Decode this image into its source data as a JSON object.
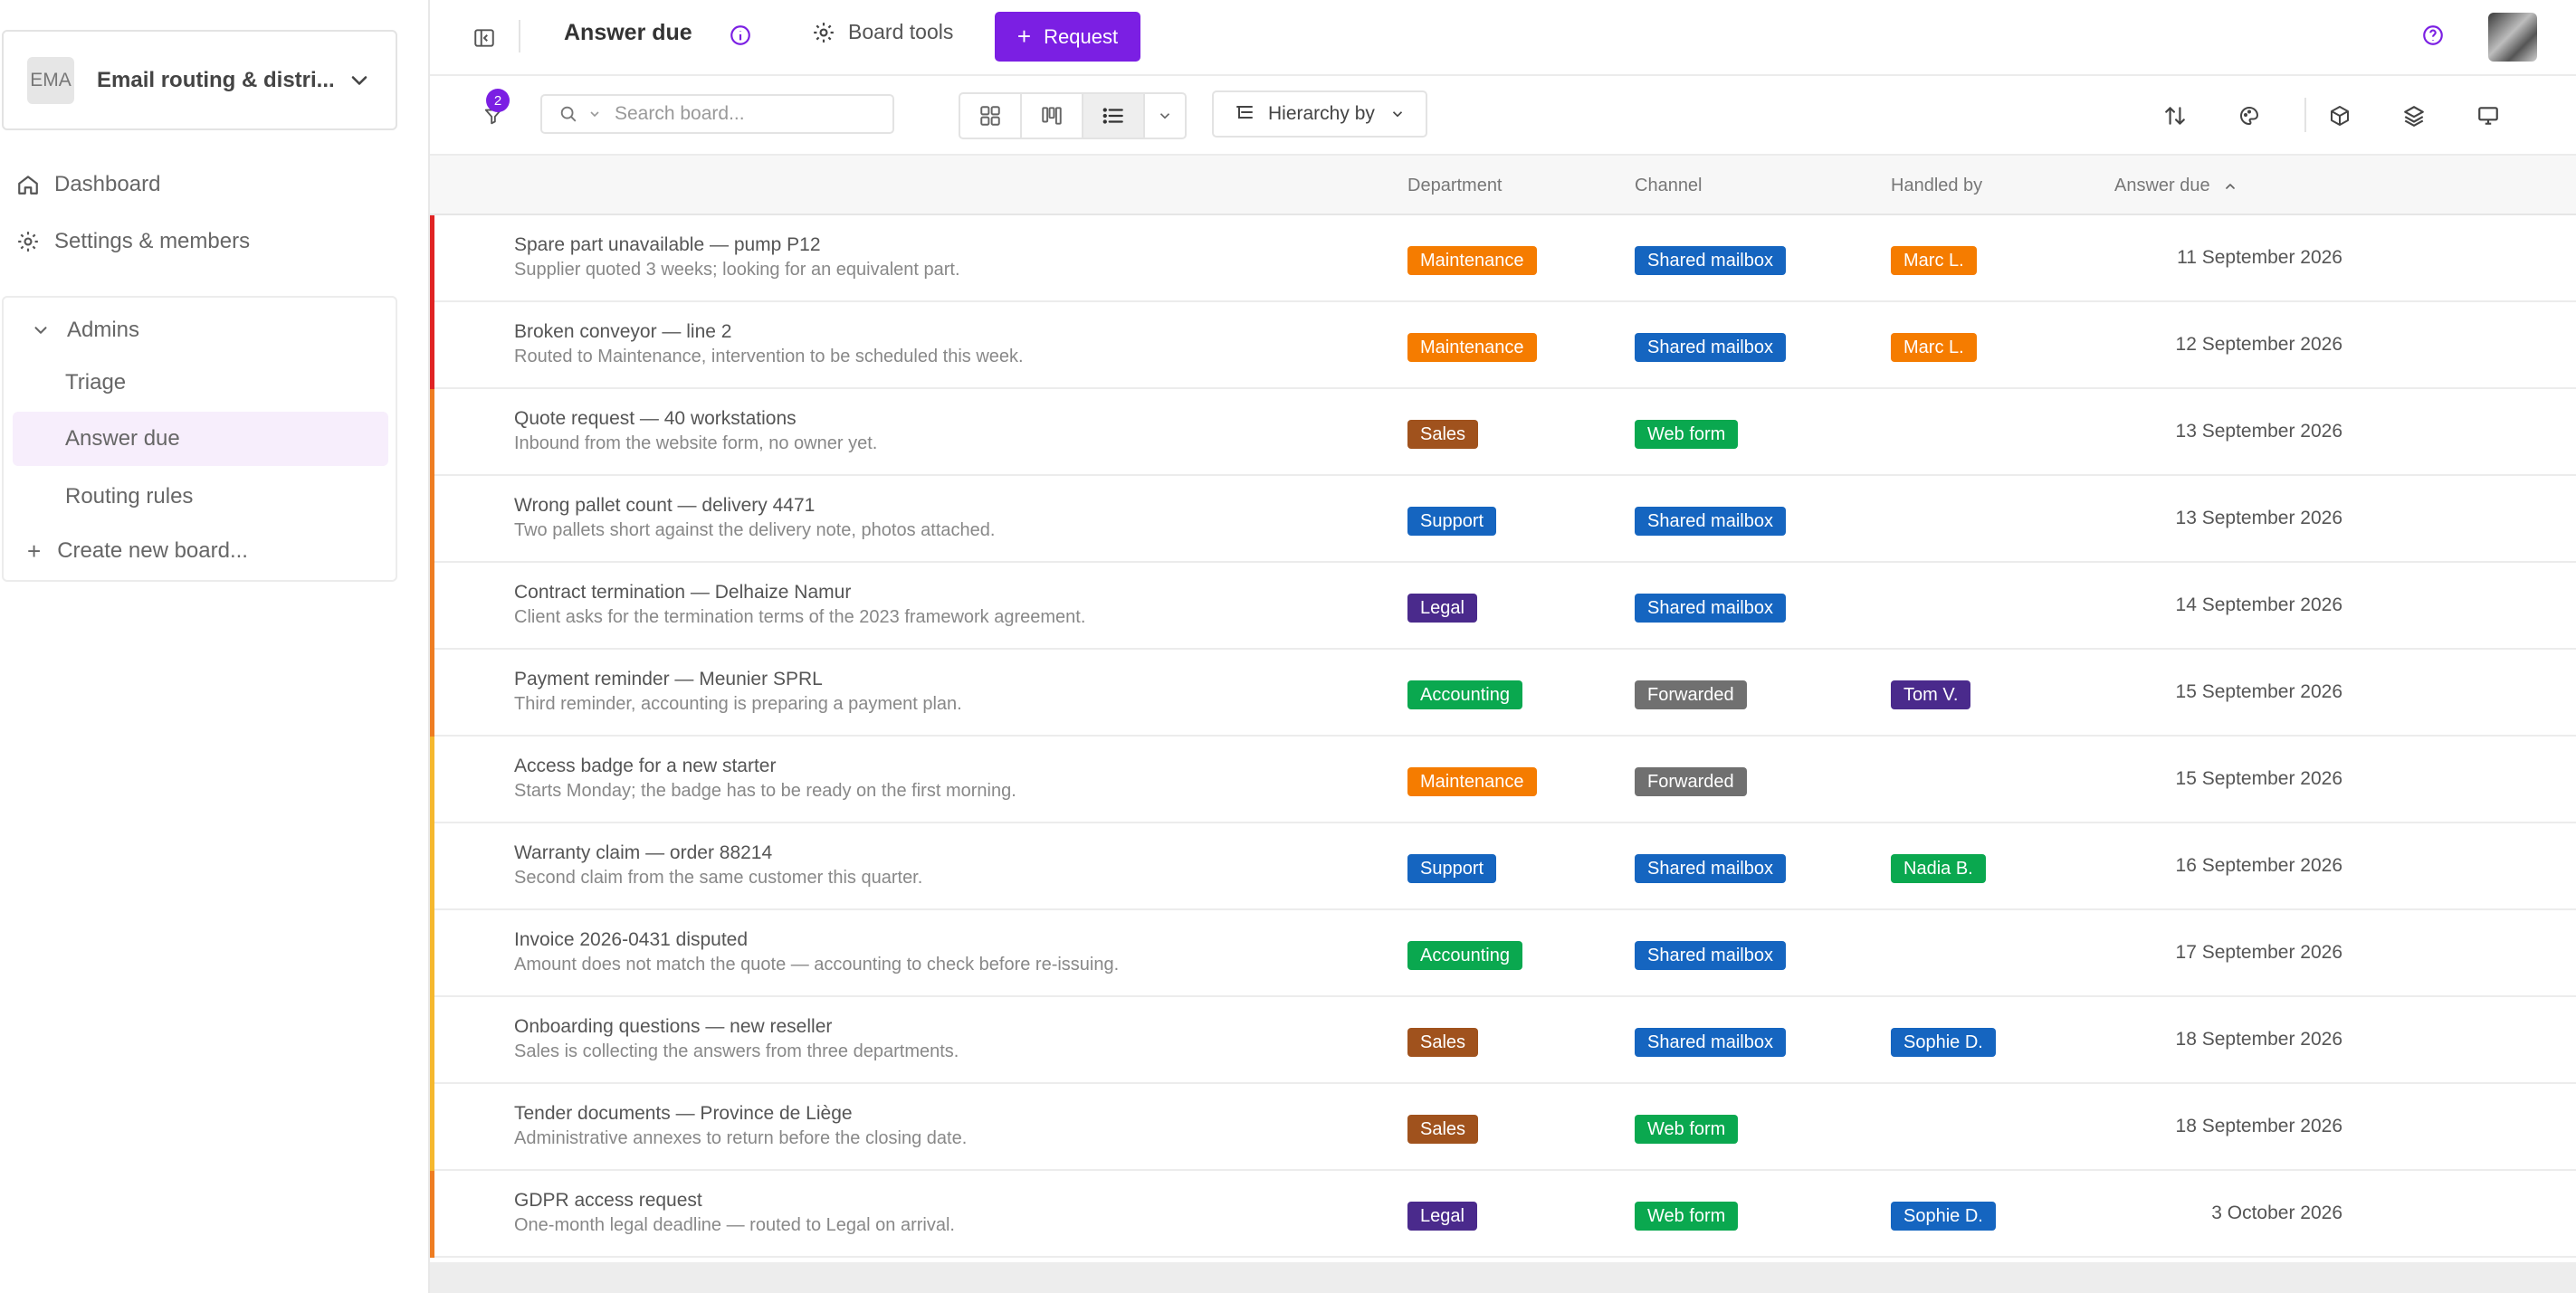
{
  "sidebar": {
    "workspace": {
      "initials": "EMA",
      "name": "Email routing & distri..."
    },
    "links": [
      {
        "label": "Dashboard",
        "icon": "home-icon"
      },
      {
        "label": "Settings & members",
        "icon": "gear-icon"
      }
    ],
    "group": {
      "label": "Admins",
      "boards": [
        "Triage",
        "Answer due",
        "Routing rules"
      ],
      "active_index": 1,
      "create_label": "Create new board..."
    }
  },
  "topbar": {
    "title": "Answer due",
    "board_tools_label": "Board tools",
    "request_label": "Request"
  },
  "toolbar": {
    "filter_count": "2",
    "search_placeholder": "Search board...",
    "hierarchy_label": "Hierarchy by"
  },
  "table": {
    "columns": {
      "department": "Department",
      "channel": "Channel",
      "handled_by": "Handled by",
      "answer_due": "Answer due"
    },
    "rows": [
      {
        "title": "Spare part unavailable — pump P12",
        "subtitle": "Supplier quoted 3 weeks; looking for an equivalent part.",
        "priority_color": "#e02424",
        "department": "Maintenance",
        "channel": "Shared mailbox",
        "handled_by": "Marc L.",
        "answer_due": "11 September 2026"
      },
      {
        "title": "Broken conveyor — line 2",
        "subtitle": "Routed to Maintenance, intervention to be scheduled this week.",
        "priority_color": "#e02424",
        "department": "Maintenance",
        "channel": "Shared mailbox",
        "handled_by": "Marc L.",
        "answer_due": "12 September 2026"
      },
      {
        "title": "Quote request — 40 workstations",
        "subtitle": "Inbound from the website form, no owner yet.",
        "priority_color": "#ee7d22",
        "department": "Sales",
        "channel": "Web form",
        "handled_by": "",
        "answer_due": "13 September 2026"
      },
      {
        "title": "Wrong pallet count — delivery 4471",
        "subtitle": "Two pallets short against the delivery note, photos attached.",
        "priority_color": "#ee7d22",
        "department": "Support",
        "channel": "Shared mailbox",
        "handled_by": "",
        "answer_due": "13 September 2026"
      },
      {
        "title": "Contract termination — Delhaize Namur",
        "subtitle": "Client asks for the termination terms of the 2023 framework agreement.",
        "priority_color": "#ee7d22",
        "department": "Legal",
        "channel": "Shared mailbox",
        "handled_by": "",
        "answer_due": "14 September 2026"
      },
      {
        "title": "Payment reminder — Meunier SPRL",
        "subtitle": "Third reminder, accounting is preparing a payment plan.",
        "priority_color": "#ee7d22",
        "department": "Accounting",
        "channel": "Forwarded",
        "handled_by": "Tom V.",
        "answer_due": "15 September 2026"
      },
      {
        "title": "Access badge for a new starter",
        "subtitle": "Starts Monday; the badge has to be ready on the first morning.",
        "priority_color": "#f5b82e",
        "department": "Maintenance",
        "channel": "Forwarded",
        "handled_by": "",
        "answer_due": "15 September 2026"
      },
      {
        "title": "Warranty claim — order 88214",
        "subtitle": "Second claim from the same customer this quarter.",
        "priority_color": "#f5b82e",
        "department": "Support",
        "channel": "Shared mailbox",
        "handled_by": "Nadia B.",
        "answer_due": "16 September 2026"
      },
      {
        "title": "Invoice 2026-0431 disputed",
        "subtitle": "Amount does not match the quote — accounting to check before re-issuing.",
        "priority_color": "#f5b82e",
        "department": "Accounting",
        "channel": "Shared mailbox",
        "handled_by": "",
        "answer_due": "17 September 2026"
      },
      {
        "title": "Onboarding questions — new reseller",
        "subtitle": "Sales is collecting the answers from three departments.",
        "priority_color": "#f5b82e",
        "department": "Sales",
        "channel": "Shared mailbox",
        "handled_by": "Sophie D.",
        "answer_due": "18 September 2026"
      },
      {
        "title": "Tender documents — Province de Liège",
        "subtitle": "Administrative annexes to return before the closing date.",
        "priority_color": "#f5b82e",
        "department": "Sales",
        "channel": "Web form",
        "handled_by": "",
        "answer_due": "18 September 2026"
      },
      {
        "title": "GDPR access request",
        "subtitle": "One-month legal deadline — routed to Legal on arrival.",
        "priority_color": "#ee7d22",
        "department": "Legal",
        "channel": "Web form",
        "handled_by": "Sophie D.",
        "answer_due": "3 October 2026"
      }
    ]
  },
  "colors": {
    "accent": "#7b1fe3",
    "department": {
      "Maintenance": "#f57c00",
      "Sales": "#a0521d",
      "Support": "#1565c0",
      "Legal": "#4a2a8c",
      "Accounting": "#0aa84f"
    },
    "channel": {
      "Shared mailbox": "#1565c0",
      "Web form": "#0aa84f",
      "Forwarded": "#707070"
    },
    "handler": {
      "Marc L.": "#f57c00",
      "Tom V.": "#4a2a8c",
      "Nadia B.": "#0aa84f",
      "Sophie D.": "#1565c0"
    }
  }
}
